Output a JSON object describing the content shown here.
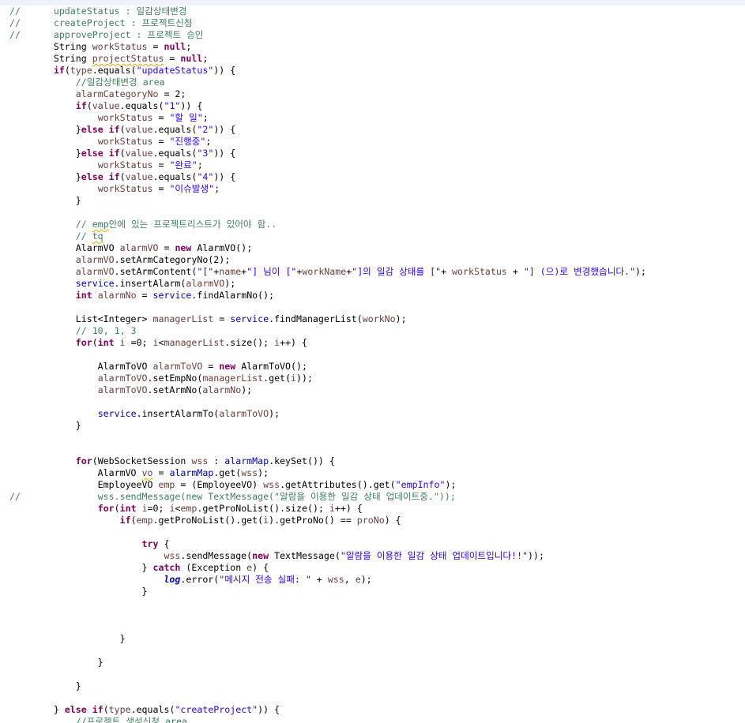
{
  "editor": {
    "language": "java",
    "colors": {
      "comment": "#3f7f5f",
      "keyword": "#7f0055",
      "string": "#2a00ff",
      "field": "#0000c0",
      "local": "#6a3e3e",
      "background": "#ffffff"
    },
    "lines": [
      [
        {
          "t": "//      updateStatus : 일감상태변경",
          "c": "comment"
        }
      ],
      [
        {
          "t": "//      createProject : 프로젝트신청",
          "c": "comment"
        }
      ],
      [
        {
          "t": "//      approveProject : 프로젝트 승인",
          "c": "comment"
        }
      ],
      [
        {
          "t": "        String "
        },
        {
          "t": "workStatus",
          "c": "local"
        },
        {
          "t": " = "
        },
        {
          "t": "null",
          "c": "keyword"
        },
        {
          "t": ";"
        }
      ],
      [
        {
          "t": "        String "
        },
        {
          "t": "projectStatus",
          "c": "local squiggle"
        },
        {
          "t": " = "
        },
        {
          "t": "null",
          "c": "keyword"
        },
        {
          "t": ";"
        }
      ],
      [
        {
          "t": "        "
        },
        {
          "t": "if",
          "c": "keyword"
        },
        {
          "t": "("
        },
        {
          "t": "type",
          "c": "local"
        },
        {
          "t": ".equals("
        },
        {
          "t": "\"updateStatus\"",
          "c": "string"
        },
        {
          "t": ")) {"
        }
      ],
      [
        {
          "t": "            //일감상태변경 area",
          "c": "comment"
        }
      ],
      [
        {
          "t": "            "
        },
        {
          "t": "alarmCategoryNo",
          "c": "local"
        },
        {
          "t": " = 2;"
        }
      ],
      [
        {
          "t": "            "
        },
        {
          "t": "if",
          "c": "keyword"
        },
        {
          "t": "("
        },
        {
          "t": "value",
          "c": "local"
        },
        {
          "t": ".equals("
        },
        {
          "t": "\"1\"",
          "c": "string"
        },
        {
          "t": ")) {"
        }
      ],
      [
        {
          "t": "                "
        },
        {
          "t": "workStatus",
          "c": "local"
        },
        {
          "t": " = "
        },
        {
          "t": "\"할 일\"",
          "c": "string"
        },
        {
          "t": ";"
        }
      ],
      [
        {
          "t": "            }"
        },
        {
          "t": "else",
          "c": "keyword"
        },
        {
          "t": " "
        },
        {
          "t": "if",
          "c": "keyword"
        },
        {
          "t": "("
        },
        {
          "t": "value",
          "c": "local"
        },
        {
          "t": ".equals("
        },
        {
          "t": "\"2\"",
          "c": "string"
        },
        {
          "t": ")) {"
        }
      ],
      [
        {
          "t": "                "
        },
        {
          "t": "workStatus",
          "c": "local"
        },
        {
          "t": " = "
        },
        {
          "t": "\"진행중\"",
          "c": "string"
        },
        {
          "t": ";"
        }
      ],
      [
        {
          "t": "            }"
        },
        {
          "t": "else",
          "c": "keyword"
        },
        {
          "t": " "
        },
        {
          "t": "if",
          "c": "keyword"
        },
        {
          "t": "("
        },
        {
          "t": "value",
          "c": "local"
        },
        {
          "t": ".equals("
        },
        {
          "t": "\"3\"",
          "c": "string"
        },
        {
          "t": ")) {"
        }
      ],
      [
        {
          "t": "                "
        },
        {
          "t": "workStatus",
          "c": "local"
        },
        {
          "t": " = "
        },
        {
          "t": "\"완료\"",
          "c": "string"
        },
        {
          "t": ";"
        }
      ],
      [
        {
          "t": "            }"
        },
        {
          "t": "else",
          "c": "keyword"
        },
        {
          "t": " "
        },
        {
          "t": "if",
          "c": "keyword"
        },
        {
          "t": "("
        },
        {
          "t": "value",
          "c": "local"
        },
        {
          "t": ".equals("
        },
        {
          "t": "\"4\"",
          "c": "string"
        },
        {
          "t": ")) {"
        }
      ],
      [
        {
          "t": "                "
        },
        {
          "t": "workStatus",
          "c": "local"
        },
        {
          "t": " = "
        },
        {
          "t": "\"이슈발생\"",
          "c": "string"
        },
        {
          "t": ";"
        }
      ],
      [
        {
          "t": "            }"
        }
      ],
      [
        {
          "t": ""
        }
      ],
      [
        {
          "t": "            // ",
          "c": "comment"
        },
        {
          "t": "emp",
          "c": "comment squiggle"
        },
        {
          "t": "안에 있는 프로젝트리스트가 있어야 함..",
          "c": "comment"
        }
      ],
      [
        {
          "t": "            // ",
          "c": "comment"
        },
        {
          "t": "tq",
          "c": "comment squiggle"
        }
      ],
      [
        {
          "t": "            AlarmVO "
        },
        {
          "t": "alarmVO",
          "c": "local"
        },
        {
          "t": " = "
        },
        {
          "t": "new",
          "c": "keyword"
        },
        {
          "t": " AlarmVO();"
        }
      ],
      [
        {
          "t": "            "
        },
        {
          "t": "alarmVO",
          "c": "local"
        },
        {
          "t": ".setArmCategoryNo(2);"
        }
      ],
      [
        {
          "t": "            "
        },
        {
          "t": "alarmVO",
          "c": "local"
        },
        {
          "t": ".setArmContent("
        },
        {
          "t": "\"[\"",
          "c": "string"
        },
        {
          "t": "+"
        },
        {
          "t": "name",
          "c": "local"
        },
        {
          "t": "+"
        },
        {
          "t": "\"] 님이 [\"",
          "c": "string"
        },
        {
          "t": "+"
        },
        {
          "t": "workName",
          "c": "local"
        },
        {
          "t": "+"
        },
        {
          "t": "\"]의 일감 상태를 [\"",
          "c": "string"
        },
        {
          "t": "+ "
        },
        {
          "t": "workStatus",
          "c": "local"
        },
        {
          "t": " + "
        },
        {
          "t": "\"] (으)로 변경했습니다.\"",
          "c": "string"
        },
        {
          "t": ");"
        }
      ],
      [
        {
          "t": "            "
        },
        {
          "t": "service",
          "c": "field"
        },
        {
          "t": ".insertAlarm("
        },
        {
          "t": "alarmVO",
          "c": "local"
        },
        {
          "t": ");"
        }
      ],
      [
        {
          "t": "            "
        },
        {
          "t": "int",
          "c": "keyword"
        },
        {
          "t": " "
        },
        {
          "t": "alarmNo",
          "c": "local"
        },
        {
          "t": " = "
        },
        {
          "t": "service",
          "c": "field"
        },
        {
          "t": ".findAlarmNo();"
        }
      ],
      [
        {
          "t": ""
        }
      ],
      [
        {
          "t": "            List<Integer> "
        },
        {
          "t": "managerList",
          "c": "local"
        },
        {
          "t": " = "
        },
        {
          "t": "service",
          "c": "field"
        },
        {
          "t": ".findManagerList("
        },
        {
          "t": "workNo",
          "c": "local"
        },
        {
          "t": ");"
        }
      ],
      [
        {
          "t": "            // 10, 1, 3",
          "c": "comment"
        }
      ],
      [
        {
          "t": "            "
        },
        {
          "t": "for",
          "c": "keyword"
        },
        {
          "t": "("
        },
        {
          "t": "int",
          "c": "keyword"
        },
        {
          "t": " "
        },
        {
          "t": "i",
          "c": "local"
        },
        {
          "t": " =0; "
        },
        {
          "t": "i",
          "c": "local"
        },
        {
          "t": "<"
        },
        {
          "t": "managerList",
          "c": "local"
        },
        {
          "t": ".size(); "
        },
        {
          "t": "i",
          "c": "local"
        },
        {
          "t": "++) {"
        }
      ],
      [
        {
          "t": ""
        }
      ],
      [
        {
          "t": "                AlarmToVO "
        },
        {
          "t": "alarmToVO",
          "c": "local"
        },
        {
          "t": " = "
        },
        {
          "t": "new",
          "c": "keyword"
        },
        {
          "t": " AlarmToVO();"
        }
      ],
      [
        {
          "t": "                "
        },
        {
          "t": "alarmToVO",
          "c": "local"
        },
        {
          "t": ".setEmpNo("
        },
        {
          "t": "managerList",
          "c": "local"
        },
        {
          "t": ".get("
        },
        {
          "t": "i",
          "c": "local"
        },
        {
          "t": "));"
        }
      ],
      [
        {
          "t": "                "
        },
        {
          "t": "alarmToVO",
          "c": "local"
        },
        {
          "t": ".setArmNo("
        },
        {
          "t": "alarmNo",
          "c": "local"
        },
        {
          "t": ");"
        }
      ],
      [
        {
          "t": ""
        }
      ],
      [
        {
          "t": "                "
        },
        {
          "t": "service",
          "c": "field"
        },
        {
          "t": ".insertAlarmTo("
        },
        {
          "t": "alarmToVO",
          "c": "local"
        },
        {
          "t": ");"
        }
      ],
      [
        {
          "t": "            }"
        }
      ],
      [
        {
          "t": ""
        }
      ],
      [
        {
          "t": ""
        }
      ],
      [
        {
          "t": "            "
        },
        {
          "t": "for",
          "c": "keyword"
        },
        {
          "t": "(WebSocketSession "
        },
        {
          "t": "wss",
          "c": "local"
        },
        {
          "t": " : "
        },
        {
          "t": "alarmMap",
          "c": "field"
        },
        {
          "t": ".keySet()) {"
        }
      ],
      [
        {
          "t": "                AlarmVO "
        },
        {
          "t": "vo",
          "c": "local squiggle"
        },
        {
          "t": " = "
        },
        {
          "t": "alarmMap",
          "c": "field"
        },
        {
          "t": ".get("
        },
        {
          "t": "wss",
          "c": "local"
        },
        {
          "t": ");"
        }
      ],
      [
        {
          "t": "                EmployeeVO "
        },
        {
          "t": "emp",
          "c": "local"
        },
        {
          "t": " = (EmployeeVO) "
        },
        {
          "t": "wss",
          "c": "local"
        },
        {
          "t": ".getAttributes().get("
        },
        {
          "t": "\"empInfo\"",
          "c": "string"
        },
        {
          "t": ");"
        }
      ],
      [
        {
          "t": "//              wss.sendMessage(new TextMessage(\"알람을 이용한 일감 상태 업데이트중.\"));",
          "c": "comment"
        }
      ],
      [
        {
          "t": "                "
        },
        {
          "t": "for",
          "c": "keyword"
        },
        {
          "t": "("
        },
        {
          "t": "int",
          "c": "keyword"
        },
        {
          "t": " "
        },
        {
          "t": "i",
          "c": "local"
        },
        {
          "t": "=0; "
        },
        {
          "t": "i",
          "c": "local"
        },
        {
          "t": "<"
        },
        {
          "t": "emp",
          "c": "local"
        },
        {
          "t": ".getProNoList().size(); "
        },
        {
          "t": "i",
          "c": "local"
        },
        {
          "t": "++) {"
        }
      ],
      [
        {
          "t": "                    "
        },
        {
          "t": "if",
          "c": "keyword"
        },
        {
          "t": "("
        },
        {
          "t": "emp",
          "c": "local"
        },
        {
          "t": ".getProNoList().get("
        },
        {
          "t": "i",
          "c": "local"
        },
        {
          "t": ").getProNo() == "
        },
        {
          "t": "proNo",
          "c": "local"
        },
        {
          "t": ") {"
        }
      ],
      [
        {
          "t": ""
        }
      ],
      [
        {
          "t": "                        "
        },
        {
          "t": "try",
          "c": "keyword"
        },
        {
          "t": " {"
        }
      ],
      [
        {
          "t": "                            "
        },
        {
          "t": "wss",
          "c": "local"
        },
        {
          "t": ".sendMessage("
        },
        {
          "t": "new",
          "c": "keyword"
        },
        {
          "t": " TextMessage("
        },
        {
          "t": "\"알람을 이용한 일감 상태 업데이트입니다!!\"",
          "c": "string"
        },
        {
          "t": "));"
        }
      ],
      [
        {
          "t": "                        } "
        },
        {
          "t": "catch",
          "c": "keyword"
        },
        {
          "t": " (Exception "
        },
        {
          "t": "e",
          "c": "local"
        },
        {
          "t": ") {"
        }
      ],
      [
        {
          "t": "                            "
        },
        {
          "t": "log",
          "c": "static-field"
        },
        {
          "t": ".error("
        },
        {
          "t": "\"메시지 전송 실패: \"",
          "c": "string"
        },
        {
          "t": " + "
        },
        {
          "t": "wss",
          "c": "local"
        },
        {
          "t": ", "
        },
        {
          "t": "e",
          "c": "local"
        },
        {
          "t": ");"
        }
      ],
      [
        {
          "t": "                        }"
        }
      ],
      [
        {
          "t": ""
        }
      ],
      [
        {
          "t": ""
        }
      ],
      [
        {
          "t": ""
        }
      ],
      [
        {
          "t": "                    }"
        }
      ],
      [
        {
          "t": ""
        }
      ],
      [
        {
          "t": "                }"
        }
      ],
      [
        {
          "t": ""
        }
      ],
      [
        {
          "t": "            }"
        }
      ],
      [
        {
          "t": ""
        }
      ],
      [
        {
          "t": "        } "
        },
        {
          "t": "else",
          "c": "keyword"
        },
        {
          "t": " "
        },
        {
          "t": "if",
          "c": "keyword"
        },
        {
          "t": "("
        },
        {
          "t": "type",
          "c": "local"
        },
        {
          "t": ".equals("
        },
        {
          "t": "\"createProject\"",
          "c": "string"
        },
        {
          "t": ")) {"
        }
      ],
      [
        {
          "t": "            //프로젝트 생성신청 area",
          "c": "comment"
        }
      ]
    ]
  }
}
